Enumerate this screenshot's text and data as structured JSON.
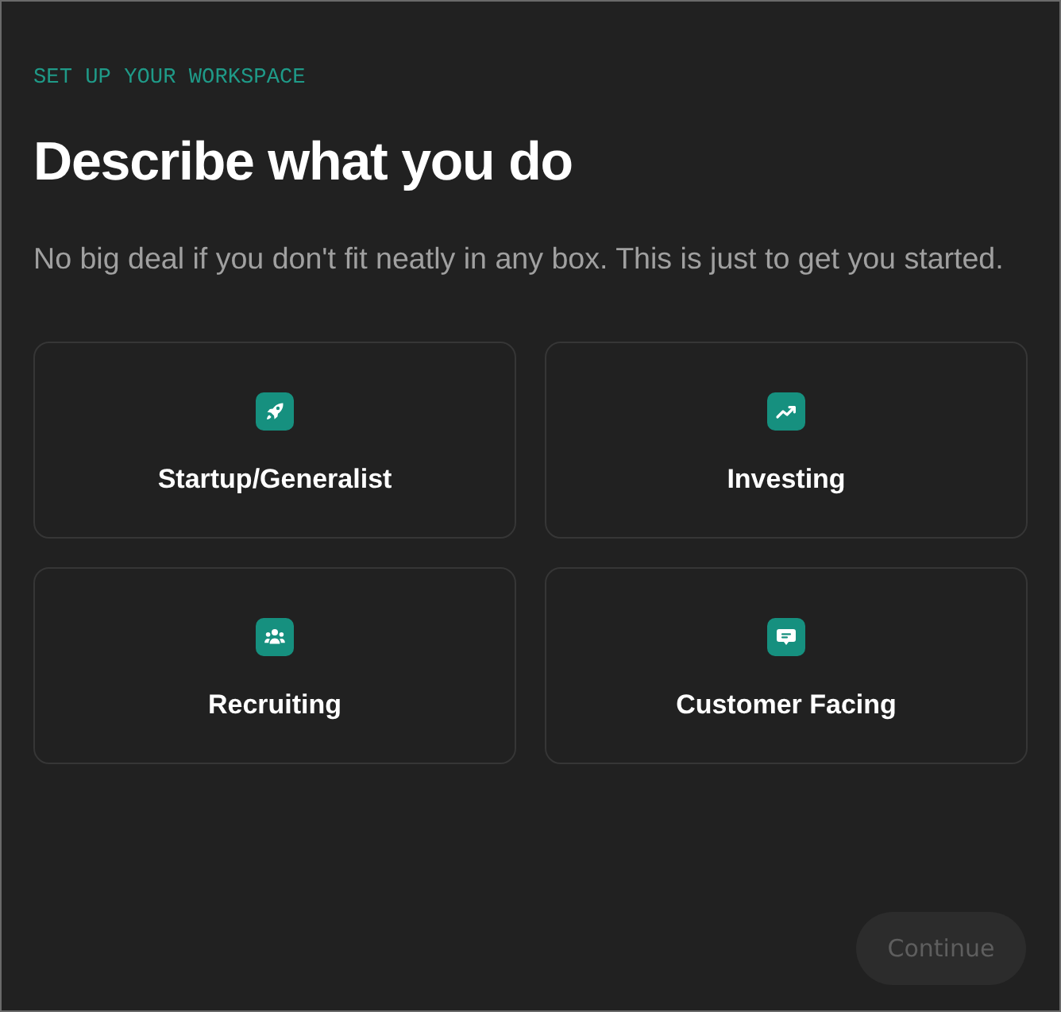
{
  "eyebrow": "SET UP YOUR WORKSPACE",
  "title": "Describe what you do",
  "subtitle": "No big deal if you don't fit neatly in any box. This is just to get you started.",
  "cards": [
    {
      "label": "Startup/Generalist",
      "selected": false
    },
    {
      "label": "Investing",
      "selected": false
    },
    {
      "label": "Recruiting",
      "selected": false
    },
    {
      "label": "Customer Facing",
      "selected": false
    }
  ],
  "continue_button": {
    "label": "Continue",
    "disabled": true
  }
}
